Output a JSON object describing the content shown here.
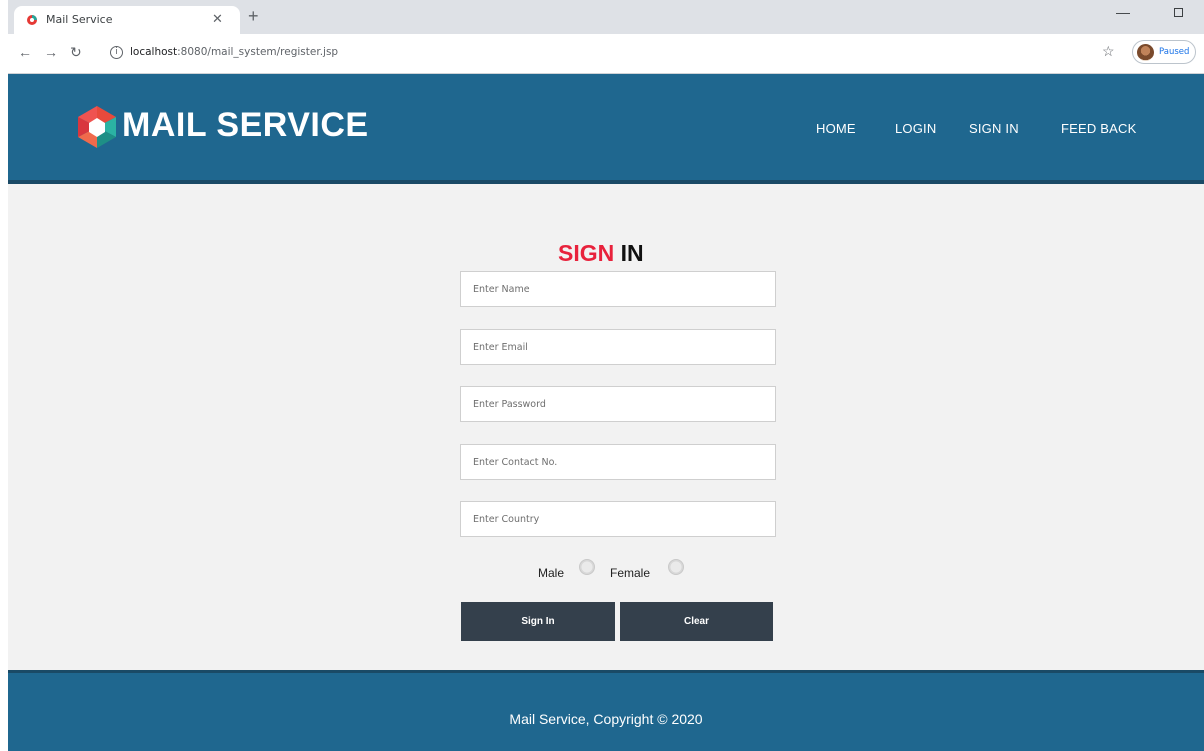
{
  "browser": {
    "tab_title": "Mail Service",
    "tab_close_icon": "close-icon",
    "new_tab_symbol": "+",
    "url_host": "localhost",
    "url_path": ":8080/mail_system/register.jsp",
    "profile_label": "Paused",
    "icons": [
      "back-icon",
      "forward-icon",
      "reload-icon",
      "info-icon",
      "star-icon",
      "minimize-icon",
      "maximize-icon"
    ]
  },
  "header": {
    "brand": "MAIL SERVICE",
    "nav": [
      "HOME",
      "LOGIN",
      "SIGN IN",
      "FEED BACK"
    ],
    "background": "#1f678f"
  },
  "form": {
    "title_part1": "SIGN",
    "title_part2": "IN",
    "title_accent": "#e8223c",
    "fields": [
      {
        "placeholder": "Enter Name",
        "value": ""
      },
      {
        "placeholder": "Enter Email",
        "value": ""
      },
      {
        "placeholder": "Enter Password",
        "value": ""
      },
      {
        "placeholder": "Enter Contact No.",
        "value": ""
      },
      {
        "placeholder": "Enter Country",
        "value": ""
      }
    ],
    "gender": {
      "male_label": "Male",
      "female_label": "Female",
      "selected": null
    },
    "buttons": {
      "submit": "Sign In",
      "clear": "Clear"
    }
  },
  "footer": {
    "copyright": "Mail Service, Copyright © 2020"
  }
}
